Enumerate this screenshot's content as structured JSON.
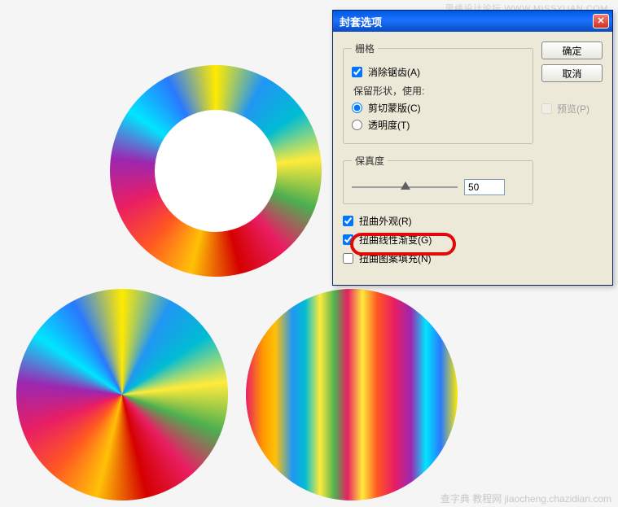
{
  "watermarks": {
    "top": "思缘设计论坛 WWW.MISSYUAN.COM",
    "bottom": "查字典 教程网 jiaocheng.chazidian.com"
  },
  "dialog": {
    "title": "封套选项",
    "buttons": {
      "ok": "确定",
      "cancel": "取消",
      "preview": "预览(P)"
    },
    "grid": {
      "legend": "栅格",
      "antialias": "消除锯齿(A)",
      "preserve_label": "保留形状，使用:",
      "clip_mask": "剪切蒙版(C)",
      "transparency": "透明度(T)"
    },
    "fidelity": {
      "legend": "保真度",
      "value": "50"
    },
    "checks": {
      "distort_appearance": "扭曲外观(R)",
      "distort_linear_gradient": "扭曲线性渐变(G)",
      "distort_pattern_fill": "扭曲图案填充(N)"
    }
  }
}
